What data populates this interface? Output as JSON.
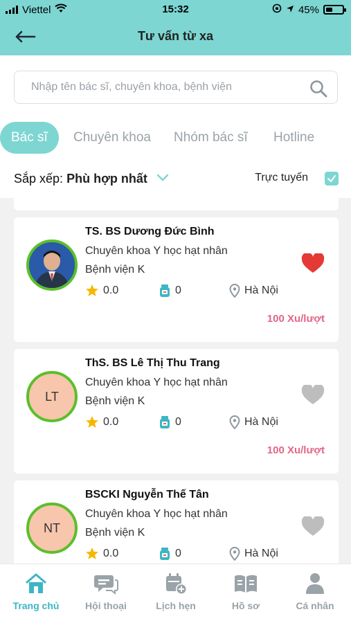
{
  "status": {
    "carrier": "Viettel",
    "time": "15:32",
    "battery": "45%"
  },
  "header": {
    "title": "Tư vấn từ xa"
  },
  "search": {
    "placeholder": "Nhập tên bác sĩ, chuyên khoa, bệnh viện"
  },
  "tabs": [
    {
      "label": "Bác sĩ",
      "active": true
    },
    {
      "label": "Chuyên khoa"
    },
    {
      "label": "Nhóm bác sĩ"
    },
    {
      "label": "Hotline"
    }
  ],
  "sort": {
    "label": "Sắp xếp:",
    "value": "Phù hợp nhất",
    "online_label": "Trực tuyến",
    "online_checked": true
  },
  "doctors": [
    {
      "name": "TS. BS Dương Đức Bình",
      "specialty": "Chuyên khoa Y học hạt nhân",
      "hospital": "Bệnh viện K",
      "rating": "0.0",
      "consults": "0",
      "location": "Hà Nội",
      "price": "100 Xu/lượt",
      "favorite": true,
      "initials": ""
    },
    {
      "name": "ThS. BS Lê Thị Thu Trang",
      "specialty": "Chuyên khoa Y học hạt nhân",
      "hospital": "Bệnh viện K",
      "rating": "0.0",
      "consults": "0",
      "location": "Hà Nội",
      "price": "100 Xu/lượt",
      "favorite": false,
      "initials": "LT"
    },
    {
      "name": "BSCKI Nguyễn Thế Tân",
      "specialty": "Chuyên khoa Y học hạt nhân",
      "hospital": "Bệnh viện K",
      "rating": "0.0",
      "consults": "0",
      "location": "Hà Nội",
      "favorite": false,
      "initials": "NT"
    }
  ],
  "bottom_nav": [
    {
      "label": "Trang chủ",
      "icon": "home-icon",
      "active": true
    },
    {
      "label": "Hội thoại",
      "icon": "chat-icon"
    },
    {
      "label": "Lịch hẹn",
      "icon": "calendar-add-icon"
    },
    {
      "label": "Hồ sơ",
      "icon": "record-book-icon"
    },
    {
      "label": "Cá nhân",
      "icon": "person-icon"
    }
  ],
  "colors": {
    "accent": "#7dd6d2",
    "nav_active": "#3cb6c4",
    "price": "#e36588",
    "heart_active": "#e53935",
    "heart_inactive": "#bdbdbd",
    "avatar_border": "#5bbf2a"
  }
}
